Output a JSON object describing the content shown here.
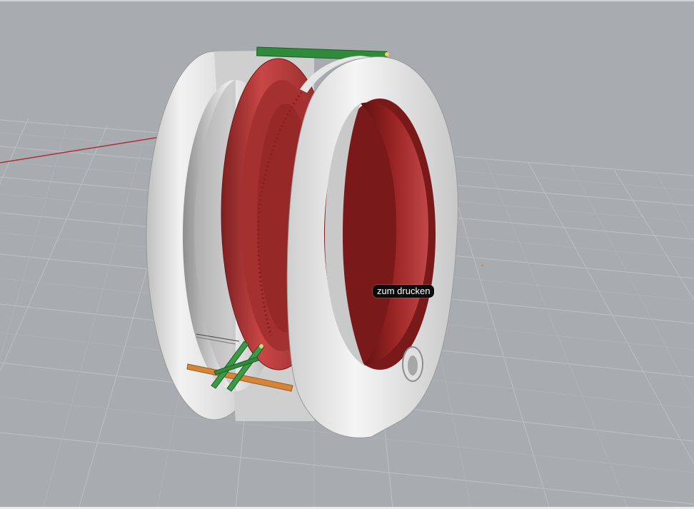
{
  "viewport": {
    "object_label": "zum drucken"
  },
  "colors": {
    "background": "#a8acb1",
    "grid_line": "#bdbfc2",
    "x_axis": "#b03030",
    "housing": "#d9d9d9",
    "ring": "#b73a3a",
    "pcb": "#2f8a3a",
    "plate": "#d4853a",
    "tooltip_bg": "#0b0b0b"
  },
  "icons": {
    "pivot_marker": "orange-dot"
  }
}
